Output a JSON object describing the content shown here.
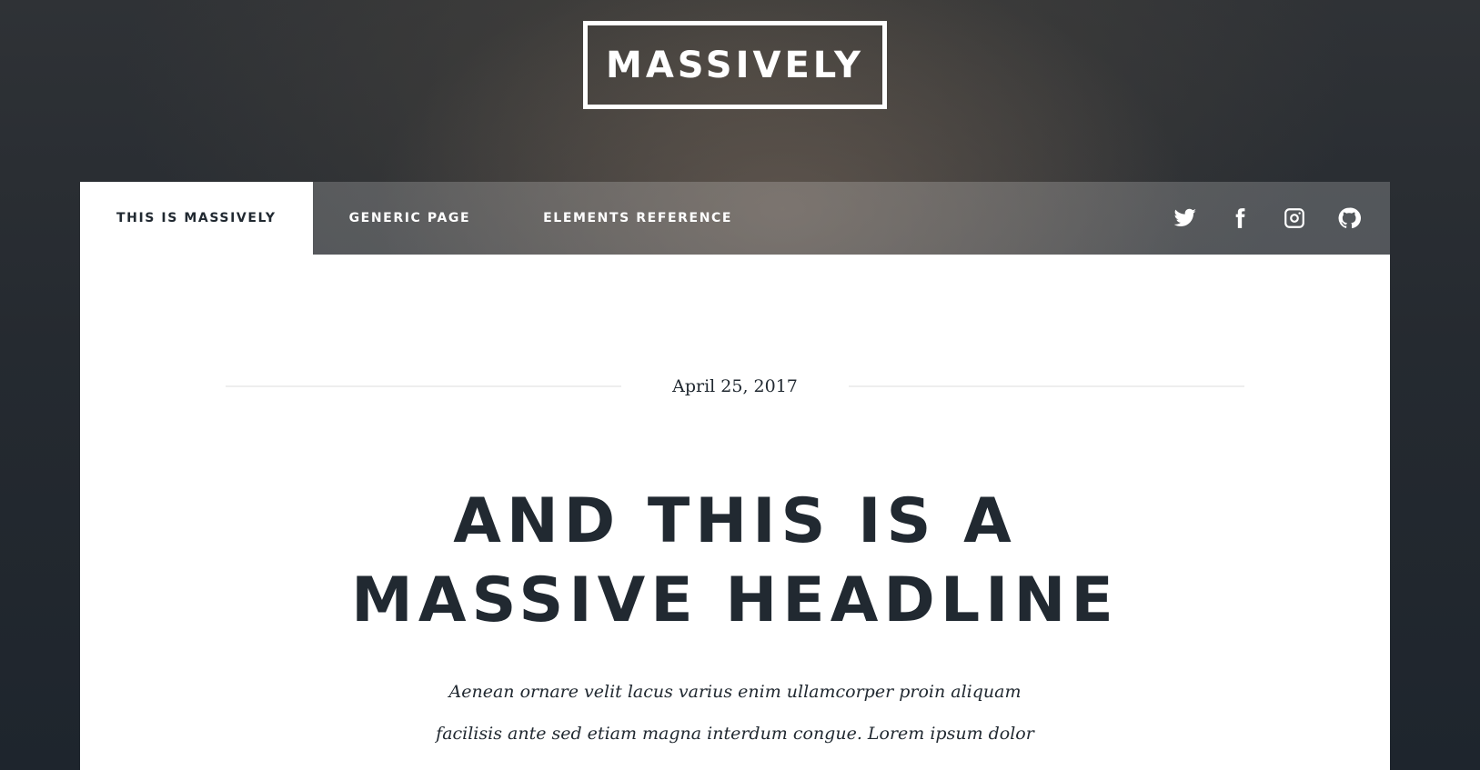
{
  "header": {
    "logo_text": "MASSIVELY"
  },
  "nav": {
    "links": [
      {
        "label": "THIS IS MASSIVELY",
        "active": true
      },
      {
        "label": "GENERIC PAGE",
        "active": false
      },
      {
        "label": "ELEMENTS REFERENCE",
        "active": false
      }
    ],
    "icons": [
      "twitter-icon",
      "facebook-icon",
      "instagram-icon",
      "github-icon"
    ]
  },
  "post": {
    "date": "April 25, 2017",
    "headline_lines": [
      "AND THIS IS A",
      "MASSIVE HEADLINE"
    ],
    "intro_lines": [
      "Aenean ornare velit lacus varius enim ullamcorper proin aliquam",
      "facilisis ante sed etiam magna interdum congue. Lorem ipsum dolor"
    ]
  },
  "colors": {
    "text_dark": "#212931",
    "background": "#1e252d",
    "panel": "#ffffff",
    "accent_white": "#ffffff"
  }
}
